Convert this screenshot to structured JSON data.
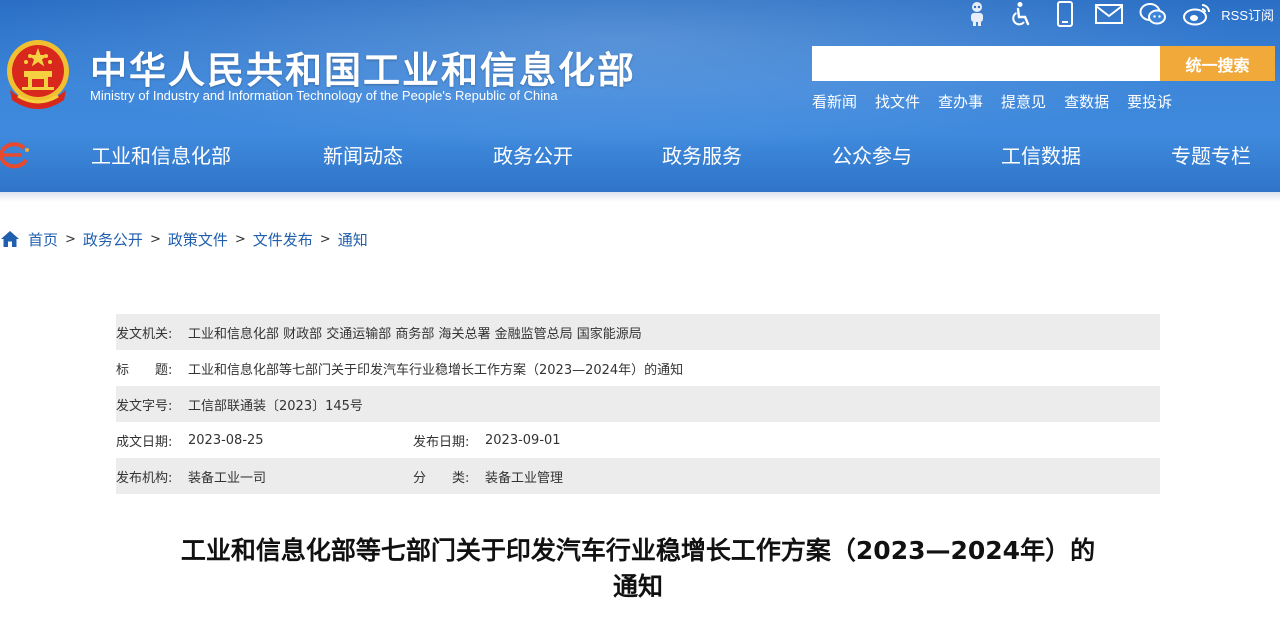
{
  "header": {
    "site_title": "中华人民共和国工业和信息化部",
    "site_subtitle": "Ministry of Industry and Information Technology of the People's Republic of China",
    "top_icons": [
      "robot-icon",
      "accessibility-icon",
      "mobile-icon",
      "mail-icon",
      "wechat-icon",
      "weibo-icon"
    ],
    "rss_label": "RSS订阅",
    "search": {
      "placeholder": "",
      "button_label": "统一搜索"
    },
    "quick_links": [
      "看新闻",
      "找文件",
      "查办事",
      "提意见",
      "查数据",
      "要投诉"
    ],
    "nav": [
      "工业和信息化部",
      "新闻动态",
      "政务公开",
      "政务服务",
      "公众参与",
      "工信数据",
      "专题专栏"
    ]
  },
  "breadcrumb": [
    "首页",
    "政务公开",
    "政策文件",
    "文件发布",
    "通知"
  ],
  "info": {
    "issuing_org_label": "发文机关:",
    "issuing_org": "工业和信息化部 财政部 交通运输部 商务部 海关总署 金融监管总局 国家能源局",
    "title_label": "标　　题:",
    "title": "工业和信息化部等七部门关于印发汽车行业稳增长工作方案（2023—2024年）的通知",
    "doc_no_label": "发文字号:",
    "doc_no": "工信部联通装〔2023〕145号",
    "written_date_label": "成文日期:",
    "written_date": "2023-08-25",
    "publish_date_label": "发布日期:",
    "publish_date": "2023-09-01",
    "publisher_label": "发布机构:",
    "publisher": "装备工业一司",
    "category_label": "分　　类:",
    "category": "装备工业管理"
  },
  "article": {
    "title_line1": "工业和信息化部等七部门关于印发汽车行业稳增长工作方案（2023—2024年）的",
    "title_line2": "通知"
  },
  "colors": {
    "header_blue": "#3d86da",
    "search_button": "#f1a93a",
    "link_blue": "#1f5fae",
    "row_shade": "#ececec"
  }
}
